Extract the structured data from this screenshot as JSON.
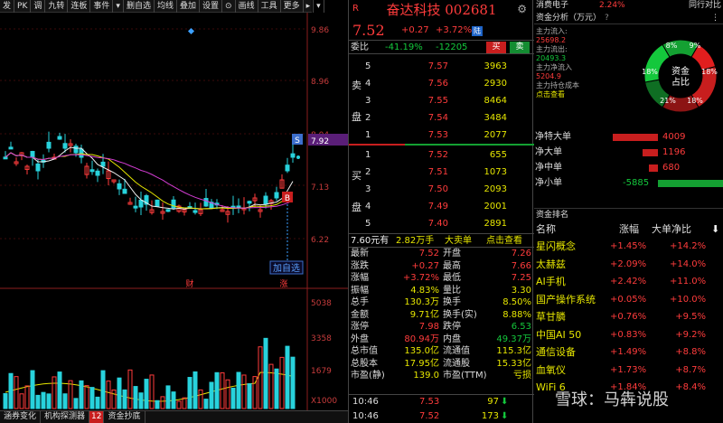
{
  "toolbar": {
    "items": [
      "发",
      "PK",
      "调",
      "九转",
      "连板",
      "事件",
      "▾",
      "删自选",
      "均线",
      "叠加",
      "设置",
      "⊙",
      "画线",
      "工具",
      "更多",
      "▸",
      "▾"
    ]
  },
  "chart": {
    "price_labels": [
      "9.86",
      "8.96",
      "8.04",
      "7.92",
      "7.13",
      "6.22"
    ],
    "vol_labels": [
      "5038",
      "3358",
      "1679",
      "X1000"
    ],
    "add_watch": "加自选",
    "badge_s": "S",
    "badge_b": "B",
    "event_cai": "财",
    "event_zhang": "涨",
    "colors": {
      "up": "#ff3c3c",
      "down": "#28d2dc",
      "ma5": "#f0f0f0",
      "ma10": "#e6e600",
      "ma20": "#d23cd2"
    }
  },
  "bottom_tabs": [
    "涵券变化",
    "机构探测器",
    "12",
    "资金抄底"
  ],
  "quote": {
    "mark": "R",
    "name": "奋达科技 002681",
    "price": "7.52",
    "change": "+0.27",
    "pct": "+3.72%",
    "board_tag": "陆",
    "webi_label": "委比",
    "webi_pct": "-41.19%",
    "webi_diff": "-12205",
    "buy_btn": "买",
    "sell_btn": "卖",
    "side_sell": [
      "卖",
      "盘"
    ],
    "side_buy": [
      "买",
      "盘"
    ],
    "asks": [
      {
        "lvl": "5",
        "px": "7.57",
        "vol": "3963"
      },
      {
        "lvl": "4",
        "px": "7.56",
        "vol": "2930"
      },
      {
        "lvl": "3",
        "px": "7.55",
        "vol": "8464"
      },
      {
        "lvl": "2",
        "px": "7.54",
        "vol": "3484"
      },
      {
        "lvl": "1",
        "px": "7.53",
        "vol": "2077"
      }
    ],
    "bids": [
      {
        "lvl": "1",
        "px": "7.52",
        "vol": "655"
      },
      {
        "lvl": "2",
        "px": "7.51",
        "vol": "1073"
      },
      {
        "lvl": "3",
        "px": "7.50",
        "vol": "2093"
      },
      {
        "lvl": "4",
        "px": "7.49",
        "vol": "2001"
      },
      {
        "lvl": "5",
        "px": "7.40",
        "vol": "2891"
      }
    ],
    "deal_line": {
      "a": "7.60元有",
      "b": "2.82万手",
      "c": "大卖单",
      "d": "点击查看"
    },
    "stats": [
      {
        "l1": "最新",
        "v1": "7.52",
        "l2": "开盘",
        "v2": "7.26"
      },
      {
        "l1": "涨跌",
        "v1": "+0.27",
        "l2": "最高",
        "v2": "7.66"
      },
      {
        "l1": "涨幅",
        "v1": "+3.72%",
        "l2": "最低",
        "v2": "7.25"
      },
      {
        "l1": "振幅",
        "v1": "4.83%",
        "l2": "量比",
        "v2": "3.30"
      },
      {
        "l1": "总手",
        "v1": "130.3万",
        "l2": "换手",
        "v2": "8.50%"
      },
      {
        "l1": "金额",
        "v1": "9.71亿",
        "l2": "换手(实)",
        "v2": "8.88%"
      },
      {
        "l1": "涨停",
        "v1": "7.98",
        "l2": "跌停",
        "v2": "6.53"
      },
      {
        "l1": "外盘",
        "v1": "80.94万",
        "l2": "内盘",
        "v2": "49.37万"
      },
      {
        "l1": "总市值",
        "v1": "135.0亿",
        "l2": "流通值",
        "v2": "115.3亿"
      },
      {
        "l1": "总股本",
        "v1": "17.95亿",
        "l2": "流通股",
        "v2": "15.33亿"
      },
      {
        "l1": "市盈(静)",
        "v1": "139.0",
        "l2": "市盈(TTM)",
        "v2": "亏损"
      }
    ],
    "ticks": [
      {
        "t": "10:46",
        "p": "7.53",
        "v": "97",
        "ar": "⬇"
      },
      {
        "t": "10:46",
        "p": "7.52",
        "v": "173",
        "ar": "⬇"
      }
    ]
  },
  "panel": {
    "sector": "消费电子",
    "sector_pct": "2.24%",
    "related": "同行对比",
    "title": "资金分析（万元）",
    "help": "?",
    "menu": "⋮",
    "flows": [
      "主力流入:",
      "25698.2",
      "主力流出:",
      "20493.3",
      "主力净流入",
      "5204.9",
      "主力持仓成本",
      "点击查看"
    ],
    "donut_center": [
      "资金",
      "占比"
    ],
    "donut_pcts": [
      "8%",
      "9%",
      "18%",
      "18%",
      "21%",
      "18%"
    ],
    "net": [
      {
        "label": "净特大单",
        "value": "4009",
        "color": "#c81e1e",
        "w": 50
      },
      {
        "label": "净大单",
        "value": "1196",
        "color": "#c81e1e",
        "w": 17
      },
      {
        "label": "净中单",
        "value": "680",
        "color": "#c81e1e",
        "w": 10
      },
      {
        "label": "净小单",
        "value": "-5885",
        "color": "#14a032",
        "w": 72
      }
    ],
    "rank_title": "资金排名",
    "rank_cols": {
      "name": "名称",
      "chg": "涨幅",
      "flow": "大单净比",
      "sort": "⬇"
    },
    "rank": [
      {
        "n": "星闪概念",
        "c": "+1.45%",
        "f": "+14.2%"
      },
      {
        "n": "太赫兹",
        "c": "+2.09%",
        "f": "+14.0%"
      },
      {
        "n": "AI手机",
        "c": "+2.42%",
        "f": "+11.0%"
      },
      {
        "n": "国产操作系统",
        "c": "+0.05%",
        "f": "+10.0%"
      },
      {
        "n": "草甘膦",
        "c": "+0.76%",
        "f": "+9.5%"
      },
      {
        "n": "中国AI 50",
        "c": "+0.83%",
        "f": "+9.2%"
      },
      {
        "n": "通信设备",
        "c": "+1.49%",
        "f": "+8.8%"
      },
      {
        "n": "血氧仪",
        "c": "+1.73%",
        "f": "+8.7%"
      },
      {
        "n": "WiFi 6",
        "c": "+1.84%",
        "f": "+8.4%"
      }
    ],
    "watermark": "雪球：马犇说股"
  }
}
